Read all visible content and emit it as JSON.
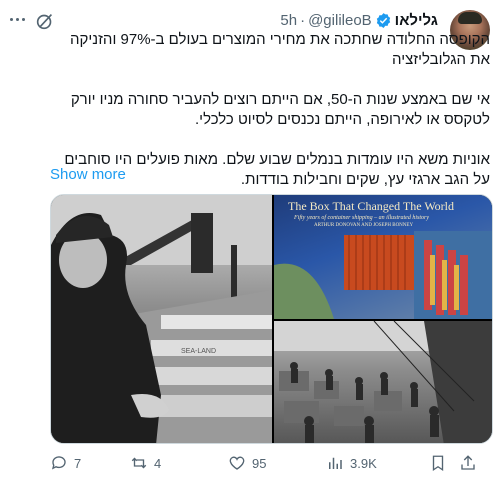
{
  "header": {
    "name": "גלילאו",
    "handle": "@gilileoB",
    "separator": "·",
    "time": "5h",
    "icons": {
      "more": "more-dots-icon",
      "grok": "grok-icon",
      "verified": "verified-badge-icon"
    },
    "colors": {
      "verified": "#1d9bf0",
      "secondary": "#536471"
    }
  },
  "tweet": {
    "paragraphs": [
      "הקופסה החלודה שחתכה את מחירי המוצרים בעולם ב-97% והזניקה את הגלובליזציה",
      "אי שם באמצע שנות ה-50, אם הייתם רוצים להעביר סחורה מניו יורק לטקסס או לאירופה, הייתם נכנסים לסיוט כלכלי.",
      "אוניות משא היו עומדות בנמלים שבוע שלם. מאות פועלים היו סוחבים על הגב ארגזי עץ, שקים וחבילות בודדות."
    ],
    "show_more": "Show more",
    "link_color": "#1d9bf0"
  },
  "media": {
    "book_title": "The Box That Changed The World",
    "book_subtitle": "Fifty years of container shipping – an illustrated history",
    "book_authors": "ARTHUR DONOVAN AND JOSEPH BONNEY",
    "ship_label": "SEA-LAND"
  },
  "actions": {
    "replies": "7",
    "reposts": "4",
    "likes": "95",
    "views": "3.9K",
    "icons": [
      "reply-icon",
      "repost-icon",
      "like-icon",
      "views-icon",
      "bookmark-icon",
      "share-icon"
    ]
  }
}
